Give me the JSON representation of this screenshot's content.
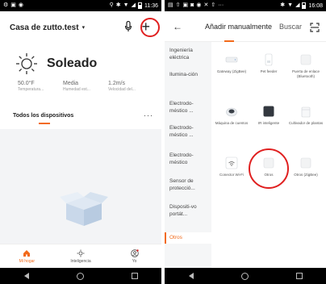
{
  "left": {
    "status": {
      "time": "11:36"
    },
    "header": {
      "title": "Casa de zutto.test",
      "chevron": "▾"
    },
    "weather": {
      "condition": "Soleado",
      "stats": [
        {
          "value": "50.0°F",
          "label": "Temperatura..."
        },
        {
          "value": "Media",
          "label": "Humedad ext..."
        },
        {
          "value": "1.2m/s",
          "label": "Velocidad del..."
        }
      ]
    },
    "devices": {
      "title": "Todos los dispositivos",
      "more": "···"
    },
    "bottomnav": [
      {
        "label": "Mi hogar",
        "icon": "home-icon",
        "active": true
      },
      {
        "label": "Inteligencia",
        "icon": "sun-icon",
        "active": false
      },
      {
        "label": "Yo",
        "icon": "person-icon",
        "active": false
      }
    ]
  },
  "right": {
    "status": {
      "time": "16:08"
    },
    "tabs": {
      "active": "Añadir manualmente",
      "other": "Buscar"
    },
    "categories": [
      {
        "label": "Ingeniería eléctrica"
      },
      {
        "label": "Ilumina-ción"
      },
      {
        "label": "Electrodo-méstico ..."
      },
      {
        "label": "Electrodo-méstico ..."
      },
      {
        "label": "Electrodo-méstico"
      },
      {
        "label": "Sensor de protecció..."
      },
      {
        "label": "Dispositi-vo portát..."
      },
      {
        "label": "Otros",
        "active": true
      }
    ],
    "devices": [
      {
        "label": "Gateway (ZigBee)",
        "icon": "gateway-icon"
      },
      {
        "label": "Pet feeder",
        "icon": "pet-feeder-icon"
      },
      {
        "label": "Puerta de enlace (Bluetooth)",
        "icon": "bluetooth-gateway-icon"
      },
      {
        "label": "Máquina de cuentos",
        "icon": "story-machine-icon"
      },
      {
        "label": "IR inteligente",
        "icon": "ir-icon"
      },
      {
        "label": "Cultivador de plantas",
        "icon": "plant-grower-icon"
      },
      {
        "label": "Conector Wi-Fi",
        "icon": "wifi-connector-icon"
      },
      {
        "label": "Otros",
        "icon": "other-wifi-icon"
      },
      {
        "label": "Otros (ZigBee)",
        "icon": "other-zigbee-icon"
      }
    ]
  },
  "colors": {
    "accent": "#f26a1b",
    "highlight": "#e02020"
  }
}
